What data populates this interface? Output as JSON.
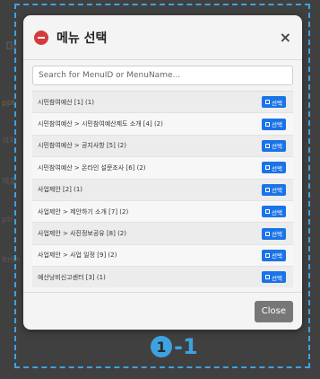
{
  "modal": {
    "title": "메뉴 선택",
    "close_icon": "×",
    "search": {
      "placeholder": "Search for MenuID or MenuName..."
    },
    "items": [
      {
        "label": "시민참여예산 [1] (1)",
        "button": "선택"
      },
      {
        "label": "시민참여예산 > 시민참여예산제도 소개 [4] (2)",
        "button": "선택"
      },
      {
        "label": "시민참여예산 > 공지사항 [5] (2)",
        "button": "선택"
      },
      {
        "label": "시민참여예산 > 온라인 설문조사 [6] (2)",
        "button": "선택"
      },
      {
        "label": "사업제안 [2] (1)",
        "button": "선택"
      },
      {
        "label": "사업제안 > 제안하기 소개 [7] (2)",
        "button": "선택"
      },
      {
        "label": "사업제안 > 사진정보공유 [8] (2)",
        "button": "선택"
      },
      {
        "label": "사업제안 > 사업 일정 [9] (2)",
        "button": "선택"
      },
      {
        "label": "예산낭비신고센터 [3] (1)",
        "button": "선택"
      }
    ],
    "footer": {
      "close_label": "Close"
    }
  },
  "annotation": {
    "number": "1",
    "suffix": "-1"
  },
  "colors": {
    "accent": "#1a73e8",
    "annotation": "#3fa2e0",
    "title_icon": "#d43c3c"
  }
}
